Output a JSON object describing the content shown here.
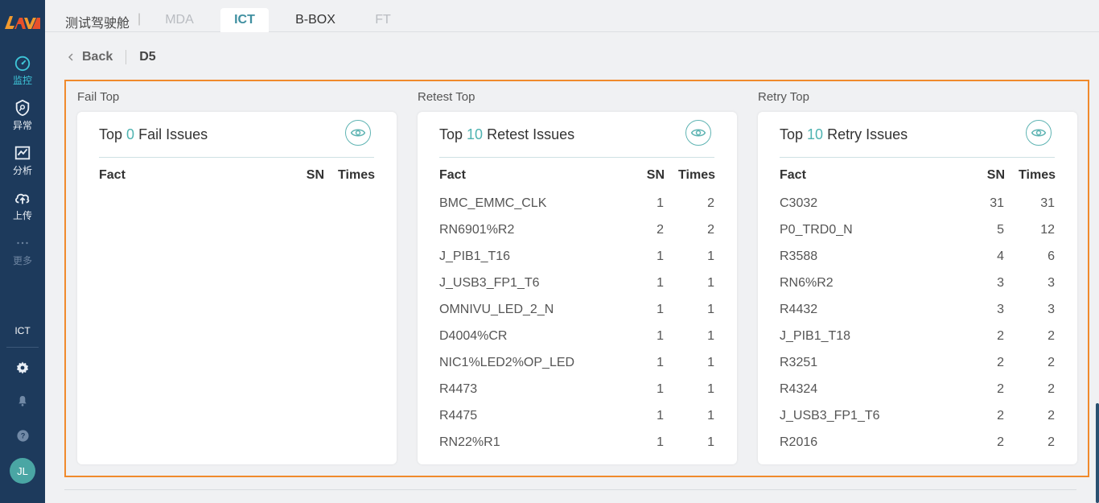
{
  "app": {
    "logo_text": "LAVA",
    "cockpit_label": "测试驾驶舱",
    "separator": "|"
  },
  "nav": {
    "items": [
      {
        "label": "监控",
        "icon": "gauge-icon",
        "active": true
      },
      {
        "label": "异常",
        "icon": "shield-icon"
      },
      {
        "label": "分析",
        "icon": "chart-icon"
      },
      {
        "label": "上传",
        "icon": "cloud-upload-icon"
      },
      {
        "label": "更多",
        "icon": "more-icon"
      }
    ],
    "section_label": "ICT",
    "avatar_initials": "JL"
  },
  "tabs": [
    {
      "label": "MDA",
      "state": "disabled"
    },
    {
      "label": "ICT",
      "state": "active"
    },
    {
      "label": "B-BOX",
      "state": "normal"
    },
    {
      "label": "FT",
      "state": "disabled"
    }
  ],
  "breadcrumb": {
    "back_label": "Back",
    "current": "D5"
  },
  "table_headers": {
    "fact": "Fact",
    "sn": "SN",
    "times": "Times"
  },
  "panels": [
    {
      "section_title": "Fail Top",
      "head_prefix": "Top",
      "head_count": "0",
      "head_suffix": "Fail Issues",
      "rows": []
    },
    {
      "section_title": "Retest Top",
      "head_prefix": "Top",
      "head_count": "10",
      "head_suffix": "Retest Issues",
      "rows": [
        {
          "fact": "BMC_EMMC_CLK",
          "sn": "1",
          "times": "2"
        },
        {
          "fact": "RN6901%R2",
          "sn": "2",
          "times": "2"
        },
        {
          "fact": "J_PIB1_T16",
          "sn": "1",
          "times": "1"
        },
        {
          "fact": "J_USB3_FP1_T6",
          "sn": "1",
          "times": "1"
        },
        {
          "fact": "OMNIVU_LED_2_N",
          "sn": "1",
          "times": "1"
        },
        {
          "fact": "D4004%CR",
          "sn": "1",
          "times": "1"
        },
        {
          "fact": "NIC1%LED2%OP_LED",
          "sn": "1",
          "times": "1"
        },
        {
          "fact": "R4473",
          "sn": "1",
          "times": "1"
        },
        {
          "fact": "R4475",
          "sn": "1",
          "times": "1"
        },
        {
          "fact": "RN22%R1",
          "sn": "1",
          "times": "1"
        }
      ]
    },
    {
      "section_title": "Retry Top",
      "head_prefix": "Top",
      "head_count": "10",
      "head_suffix": "Retry Issues",
      "rows": [
        {
          "fact": "C3032",
          "sn": "31",
          "times": "31"
        },
        {
          "fact": "P0_TRD0_N",
          "sn": "5",
          "times": "12"
        },
        {
          "fact": "R3588",
          "sn": "4",
          "times": "6"
        },
        {
          "fact": "RN6%R2",
          "sn": "3",
          "times": "3"
        },
        {
          "fact": "R4432",
          "sn": "3",
          "times": "3"
        },
        {
          "fact": "J_PIB1_T18",
          "sn": "2",
          "times": "2"
        },
        {
          "fact": "R3251",
          "sn": "2",
          "times": "2"
        },
        {
          "fact": "R4324",
          "sn": "2",
          "times": "2"
        },
        {
          "fact": "J_USB3_FP1_T6",
          "sn": "2",
          "times": "2"
        },
        {
          "fact": "R2016",
          "sn": "2",
          "times": "2"
        }
      ]
    }
  ],
  "colors": {
    "accent": "#4fb3b1",
    "sidebar": "#1d3a5c",
    "highlight_frame": "#f08a2c",
    "active_nav": "#3ec5d8"
  }
}
